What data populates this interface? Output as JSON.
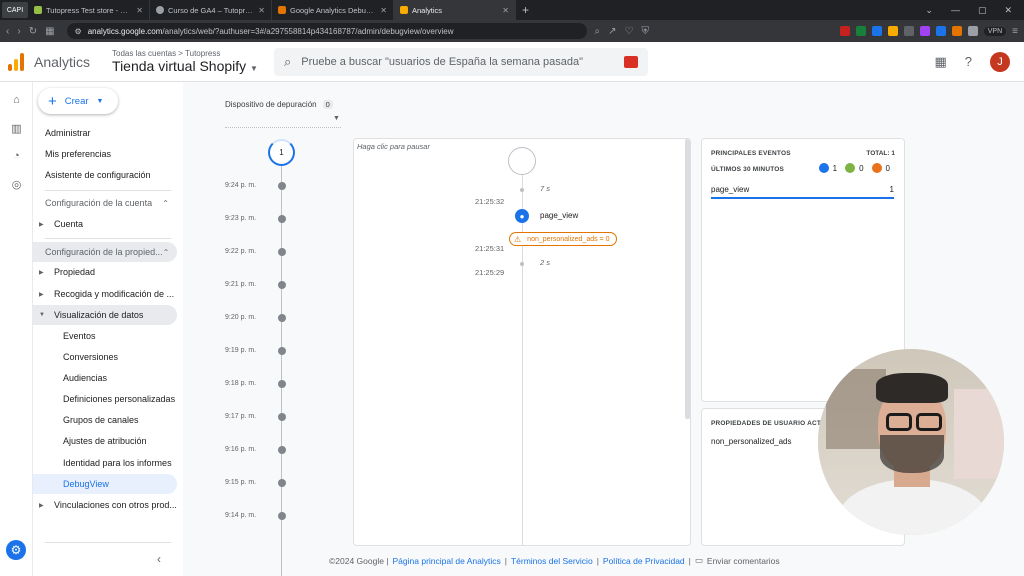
{
  "browser": {
    "tabs": [
      {
        "label": "Tutopress Test store - Get started wi",
        "color": "#96bf48",
        "active": false
      },
      {
        "label": "Curso de GA4 – Tutopress Test store",
        "color": "#9aa0a6",
        "active": false
      },
      {
        "label": "Google Analytics Debugger",
        "color": "#e37400",
        "active": false
      },
      {
        "label": "Analytics",
        "color": "#f9ab00",
        "active": true
      }
    ],
    "new_tab": "+",
    "url_host": "analytics.google.com",
    "url_path": "/analytics/web/?authuser=3#/a297558814p434168787/admin/debugview/overview",
    "vpn": "VPN",
    "brand_badge": "CAPI"
  },
  "header": {
    "brand": "Analytics",
    "breadcrumb": "Todas las cuentas > Tutopress",
    "property": "Tienda virtual Shopify",
    "search_placeholder": "Pruebe a buscar \"usuarios de España la semana pasada\"",
    "avatar_initial": "J"
  },
  "sidenav": {
    "create": "Crear",
    "items": {
      "admin": "Administrar",
      "prefs": "Mis preferencias",
      "assistant": "Asistente de configuración",
      "account_cfg": "Configuración de la cuenta",
      "account": "Cuenta",
      "property_cfg": "Configuración de la propied...",
      "property": "Propiedad",
      "collection": "Recogida y modificación de ...",
      "data_display": "Visualización de datos",
      "events": "Eventos",
      "conversions": "Conversiones",
      "audiences": "Audiencias",
      "custom_defs": "Definiciones personalizadas",
      "channel_groups": "Grupos de canales",
      "attribution": "Ajustes de atribución",
      "identity": "Identidad para los informes",
      "debugview": "DebugView",
      "links": "Vinculaciones con otros prod..."
    }
  },
  "debug": {
    "device_label": "Dispositivo de depuración",
    "device_count": "0",
    "minutes_top": "1",
    "minutes": [
      "9:24 p. m.",
      "9:23 p. m.",
      "9:22 p. m.",
      "9:21 p. m.",
      "9:20 p. m.",
      "9:19 p. m.",
      "9:18 p. m.",
      "9:17 p. m.",
      "9:16 p. m.",
      "9:15 p. m.",
      "9:14 p. m."
    ],
    "pause_hint": "Haga clic para pausar",
    "stream": {
      "dur1": "7 s",
      "ts1": "21:25:32",
      "event1": "page_view",
      "ts2": "21:25:31",
      "event2": "non_personalized_ads = 0",
      "ts3": "21:25:29",
      "dur2": "2 s"
    }
  },
  "top_events": {
    "title": "PRINCIPALES EVENTOS",
    "total": "TOTAL: 1",
    "subtitle": "ÚLTIMOS 30 MINUTOS",
    "counts": {
      "blue": "1",
      "green": "0",
      "orange": "0"
    },
    "rows": [
      {
        "name": "page_view",
        "count": "1"
      }
    ]
  },
  "user_props": {
    "title": "PROPIEDADES DE USUARIO ACTIVAS",
    "rows": [
      "non_personalized_ads"
    ]
  },
  "footer": {
    "copyright": "©2024 Google |",
    "home": "Página principal de Analytics",
    "sep1": "|",
    "terms": "Términos del Servicio",
    "sep2": "|",
    "privacy": "Política de Privacidad",
    "sep3": "|",
    "feedback": "Enviar comentarios"
  },
  "colors": {
    "accent": "#1a73e8",
    "warning": "#e37400",
    "ga_orange": "#f9ab00"
  }
}
